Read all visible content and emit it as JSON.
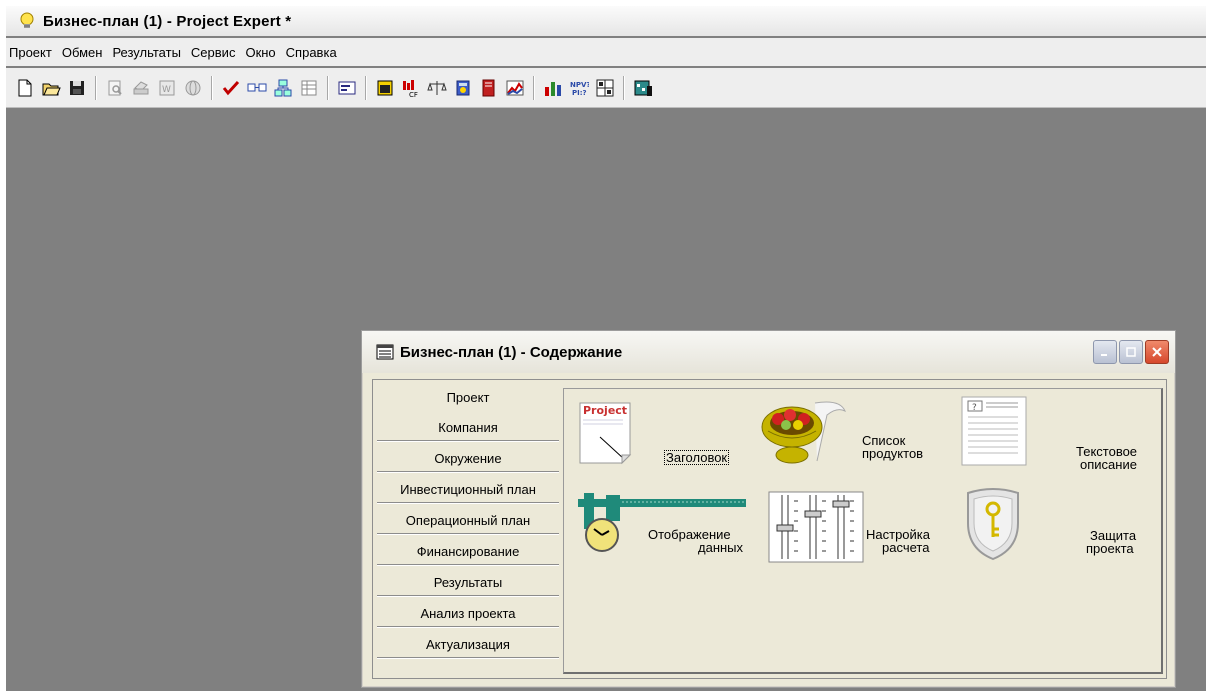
{
  "window": {
    "title": "Бизнес-план (1) - Project Expert *"
  },
  "menu": [
    "Проект",
    "Обмен",
    "Результаты",
    "Сервис",
    "Окно",
    "Справка"
  ],
  "toolbar": {
    "icons": [
      "new-file-icon",
      "open-folder-icon",
      "save-icon",
      "sep",
      "print-preview-icon",
      "print-icon",
      "report-icon",
      "sphere-icon",
      "sep",
      "check-icon",
      "compare-icon",
      "flow-icon",
      "table-icon",
      "sep",
      "card-icon",
      "sep",
      "window-icon",
      "cashflow-chart-icon",
      "balance-scales-icon",
      "calculator-icon",
      "book-icon",
      "line-chart-icon",
      "sep",
      "bar-chart-icon",
      "npv-pi-icon",
      "sensitivity-icon",
      "sep",
      "monte-carlo-icon"
    ]
  },
  "content": {
    "title": "Бизнес-план (1) - Содержание",
    "sections": [
      "Проект",
      "Компания",
      "Окружение",
      "Инвестиционный план",
      "Операционный план",
      "Финансирование",
      "Результаты",
      "Анализ проекта",
      "Актуализация"
    ],
    "active_section": "Проект",
    "items": {
      "header": {
        "logo_text": "Project",
        "label": "Заголовок"
      },
      "products": {
        "line1": "Список",
        "line2": "продуктов"
      },
      "text": {
        "line1": "Текстовое",
        "line2": "описание"
      },
      "display": {
        "line1": "Отображение",
        "line2": "данных"
      },
      "calc": {
        "line1": "Настройка",
        "line2": "расчета"
      },
      "protect": {
        "line1": "Защита",
        "line2": "проекта"
      }
    }
  }
}
